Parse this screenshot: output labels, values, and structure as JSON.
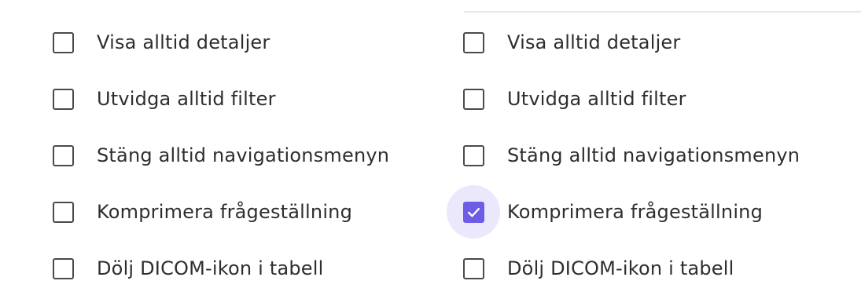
{
  "columns": [
    {
      "items": [
        {
          "label": "Visa alltid detaljer",
          "checked": false
        },
        {
          "label": "Utvidga alltid filter",
          "checked": false
        },
        {
          "label": "Stäng alltid navigationsmenyn",
          "checked": false
        },
        {
          "label": "Komprimera frågeställning",
          "checked": false
        },
        {
          "label": "Dölj DICOM-ikon i tabell",
          "checked": false
        }
      ]
    },
    {
      "items": [
        {
          "label": "Visa alltid detaljer",
          "checked": false
        },
        {
          "label": "Utvidga alltid filter",
          "checked": false
        },
        {
          "label": "Stäng alltid navigationsmenyn",
          "checked": false
        },
        {
          "label": "Komprimera frågeställning",
          "checked": true
        },
        {
          "label": "Dölj DICOM-ikon i tabell",
          "checked": false
        }
      ]
    }
  ],
  "colors": {
    "accent": "#6c5ce7",
    "focus_halo": "#ebe8fb",
    "checkbox_border": "#4a4a4a",
    "text": "#2e2e2e"
  }
}
